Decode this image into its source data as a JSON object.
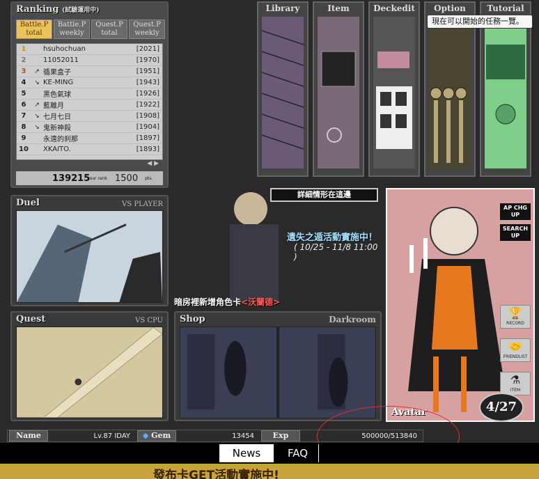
{
  "ranking": {
    "title": "Ranking",
    "subtitle": "(試驗運用中)",
    "tabs": [
      {
        "label": "Battle.P total",
        "active": true
      },
      {
        "label": "Battle.P weekly",
        "active": false
      },
      {
        "label": "Quest.P total",
        "active": false
      },
      {
        "label": "Quest.P weekly",
        "active": false
      }
    ],
    "rows": [
      {
        "rank": "1",
        "trend": "",
        "name": "hsuhochuan",
        "score": "[2021]"
      },
      {
        "rank": "2",
        "trend": "",
        "name": "11052011",
        "score": "[1970]"
      },
      {
        "rank": "3",
        "trend": "↗",
        "name": "循果盒子",
        "score": "[1951]"
      },
      {
        "rank": "4",
        "trend": "↘",
        "name": "KE-MING",
        "score": "[1943]"
      },
      {
        "rank": "5",
        "trend": "",
        "name": "黑色氣球",
        "score": "[1926]"
      },
      {
        "rank": "6",
        "trend": "↗",
        "name": "藍離月",
        "score": "[1922]"
      },
      {
        "rank": "7",
        "trend": "↘",
        "name": "七月七日",
        "score": "[1908]"
      },
      {
        "rank": "8",
        "trend": "↘",
        "name": "鬼新神殺",
        "score": "[1904]"
      },
      {
        "rank": "9",
        "trend": "",
        "name": "永遠的刹那",
        "score": "[1897]"
      },
      {
        "rank": "10",
        "trend": "",
        "name": "XKAITO.",
        "score": "[1893]"
      }
    ],
    "pager": "◀ ▶",
    "your_rank": "139215",
    "your_rank_label": "your rank",
    "pts": "1500",
    "pts_label": "pts."
  },
  "nav": [
    {
      "label": "Library"
    },
    {
      "label": "Item"
    },
    {
      "label": "Deckedit"
    },
    {
      "label": "Option"
    },
    {
      "label": "Tutorial"
    }
  ],
  "tooltip": "現在可以開始的任務一覽。",
  "duel": {
    "title": "Duel",
    "subtitle": "VS PLAYER"
  },
  "quest": {
    "title": "Quest",
    "subtitle": "VS CPU"
  },
  "shop": {
    "title": "Shop",
    "darkroom": "Darkroom"
  },
  "event": {
    "detail_label": "詳細情形在這邊",
    "line1": "遺失之遁活動實施中！",
    "date": "( 10/25 - 11/8 11:00 )",
    "new_text": "暗房裡新增角色卡",
    "new_name": "<沃蘭德>"
  },
  "avatar": {
    "label": "Avatar",
    "ap_chg": "AP CHG UP",
    "search": "SEARCH UP",
    "record": "RECORD",
    "friendlist": "FRIENDLIST",
    "item": "ITEM",
    "date": "4/27"
  },
  "status": {
    "name_label": "Name",
    "name_value": "Lv.87 IDAY",
    "gem_label": "Gem",
    "gem_value": "13454",
    "exp_label": "Exp",
    "exp_value": "500000/513840"
  },
  "tabs": {
    "news": "News",
    "faq": "FAQ"
  },
  "promo": "發布卡GET活動實施中!"
}
